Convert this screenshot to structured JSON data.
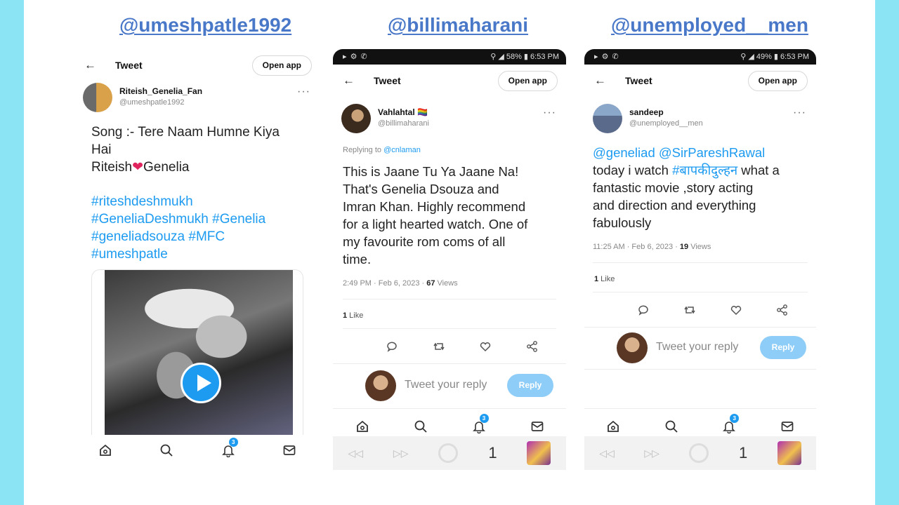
{
  "handles": [
    "@umeshpatle1992",
    "@billimaharani",
    "@unemployed__men"
  ],
  "common": {
    "header_title": "Tweet",
    "open_app": "Open app",
    "reply_placeholder": "Tweet your reply",
    "reply_button": "Reply",
    "back_arrow": "←",
    "more": "···",
    "notification_badge": "3"
  },
  "panel1": {
    "author_name": "Riteish_Genelia_Fan",
    "author_username": "@umeshpatle1992",
    "text_line1": "Song :- Tere Naam Humne Kiya",
    "text_line2": "Hai",
    "text_line3_a": "Riteish",
    "text_line3_heart": "❤",
    "text_line3_b": "Genelia",
    "tags": [
      "#riteshdeshmukh",
      "#GeneliaDeshmukh #Genelia",
      "#geneliadsouza #MFC",
      "#umeshpatle"
    ]
  },
  "panel2": {
    "status_left": "▸ ⚙ ✆",
    "status_right": "⚲ ◢ 58% ▮ 6:53 PM",
    "author_name": "Vahlahtal 🏳️‍🌈",
    "author_username": "@billimaharani",
    "replying_label": "Replying to",
    "replying_to": "@cnlaman",
    "text": [
      "This is Jaane Tu Ya Jaane Na!",
      "That's Genelia Dsouza and",
      "Imran Khan. Highly recommend",
      "for a light hearted watch. One of",
      "my favourite rom coms of all",
      "time."
    ],
    "meta_time": "2:49 PM · Feb 6, 2023 · ",
    "meta_views_count": "67",
    "meta_views_label": " Views",
    "likes_count": "1",
    "likes_label": " Like",
    "sys_number": "1"
  },
  "panel3": {
    "status_left": "▸ ⚙ ✆",
    "status_right": "⚲ ◢ 49% ▮ 6:53 PM",
    "author_name": "sandeep",
    "author_username": "@unemployed__men",
    "mention1": "@geneliad",
    "mention2": "@SirPareshRawal",
    "line2_a": "today i watch ",
    "line2_tag": "#बापकीदुल्हन",
    "line2_b": " what a",
    "text_rest": [
      "fantastic movie ,story acting",
      "and direction and everything",
      "fabulously"
    ],
    "meta_time": "11:25 AM · Feb 6, 2023 · ",
    "meta_views_count": "19",
    "meta_views_label": " Views",
    "likes_count": "1",
    "likes_label": " Like",
    "sys_number": "1"
  },
  "colors": {
    "background": "#8be4f4",
    "handle": "#4a78c8",
    "link": "#1d9bf0",
    "reply_button": "#8ecdf8"
  }
}
